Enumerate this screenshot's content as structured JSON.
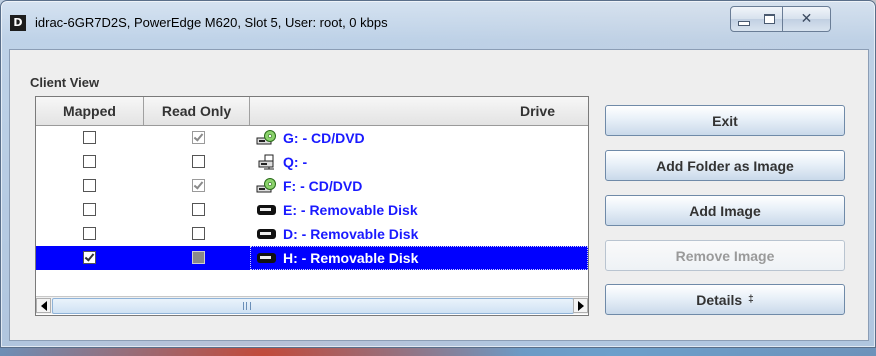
{
  "window": {
    "title": "idrac-6GR7D2S, PowerEdge M620,  Slot 5, User: root, 0 kbps",
    "app_icon_letter": "D"
  },
  "client_view": {
    "label": "Client View",
    "columns": [
      "Mapped",
      "Read Only",
      "Drive"
    ],
    "rows": [
      {
        "mapped": false,
        "read_only": true,
        "read_only_disabled": true,
        "icon": "cd-dvd-drive-icon",
        "drive": "G: - CD/DVD",
        "selected": false
      },
      {
        "mapped": false,
        "read_only": false,
        "read_only_disabled": false,
        "icon": "network-drive-icon",
        "drive": "Q: -",
        "selected": false
      },
      {
        "mapped": false,
        "read_only": true,
        "read_only_disabled": true,
        "icon": "cd-dvd-drive-icon",
        "drive": "F: - CD/DVD",
        "selected": false
      },
      {
        "mapped": false,
        "read_only": false,
        "read_only_disabled": false,
        "icon": "removable-disk-icon",
        "drive": "E: - Removable Disk",
        "selected": false
      },
      {
        "mapped": false,
        "read_only": false,
        "read_only_disabled": false,
        "icon": "removable-disk-icon",
        "drive": "D: - Removable Disk",
        "selected": false
      },
      {
        "mapped": true,
        "read_only": false,
        "read_only_disabled": true,
        "icon": "removable-disk-icon",
        "drive": "H: - Removable Disk",
        "selected": true
      }
    ]
  },
  "buttons": {
    "exit": "Exit",
    "add_folder_as_image": "Add Folder as Image",
    "add_image": "Add Image",
    "remove_image": "Remove Image",
    "details": "Details",
    "details_arrow": "‡"
  },
  "colors": {
    "selection": "#0000ff",
    "drive_text": "#1a1aff"
  }
}
